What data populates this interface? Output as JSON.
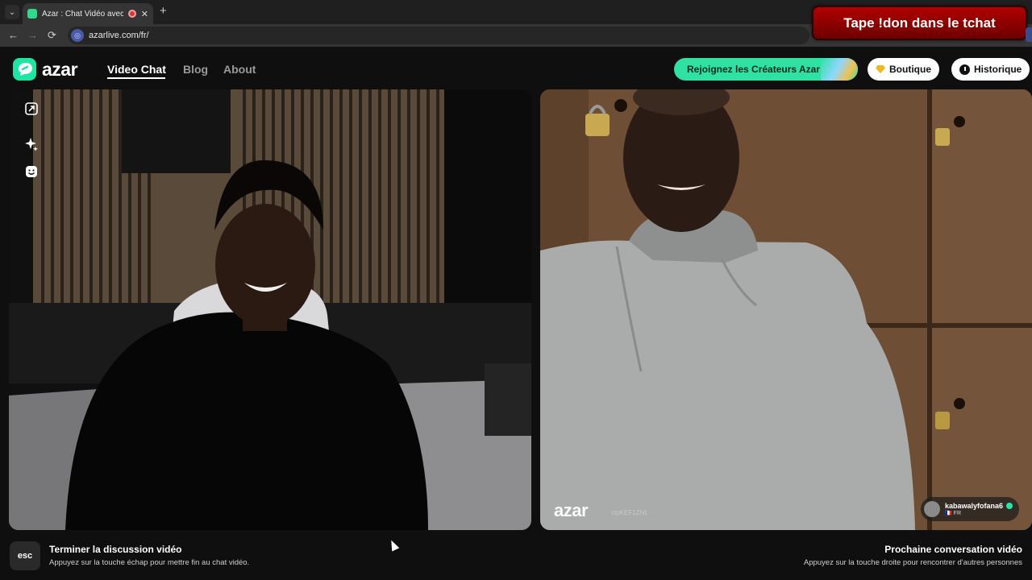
{
  "browser": {
    "tab_title": "Azar : Chat Vidéo avec de n",
    "tab_close": "✕",
    "new_tab": "+",
    "tab_list": "⌄",
    "back": "←",
    "forward": "→",
    "reload": "⟳",
    "site_icon": "◎",
    "url": "azarlive.com/fr/"
  },
  "stream_overlay": {
    "donate_text": "Tape !don dans le tchat",
    "banner_color": "#9a0000"
  },
  "header": {
    "logo_text": "azar",
    "nav": [
      {
        "label": "Video Chat",
        "active": true
      },
      {
        "label": "Blog",
        "active": false
      },
      {
        "label": "About",
        "active": false
      }
    ],
    "creators_btn": "Rejoignez les Créateurs Azar",
    "shop_btn": "Boutique",
    "history_btn": "Historique",
    "accent": "#2fe1a2"
  },
  "video": {
    "left_tools": [
      "resize-icon",
      "sparkle-effects-icon",
      "emoji-icon"
    ],
    "watermark": "azar",
    "watermark_sub": "ctpKEF1ZNL",
    "peer": {
      "name": "kabawalyfofana6",
      "country_flag": "🇫🇷",
      "country": "FR"
    }
  },
  "footer": {
    "esc_key": "esc",
    "end_title": "Terminer la discussion vidéo",
    "end_sub": "Appuyez sur la touche échap pour mettre fin au chat vidéo.",
    "next_title": "Prochaine conversation vidéo",
    "next_sub": "Appuyez sur la touche droite pour rencontrer d'autres personnes"
  }
}
